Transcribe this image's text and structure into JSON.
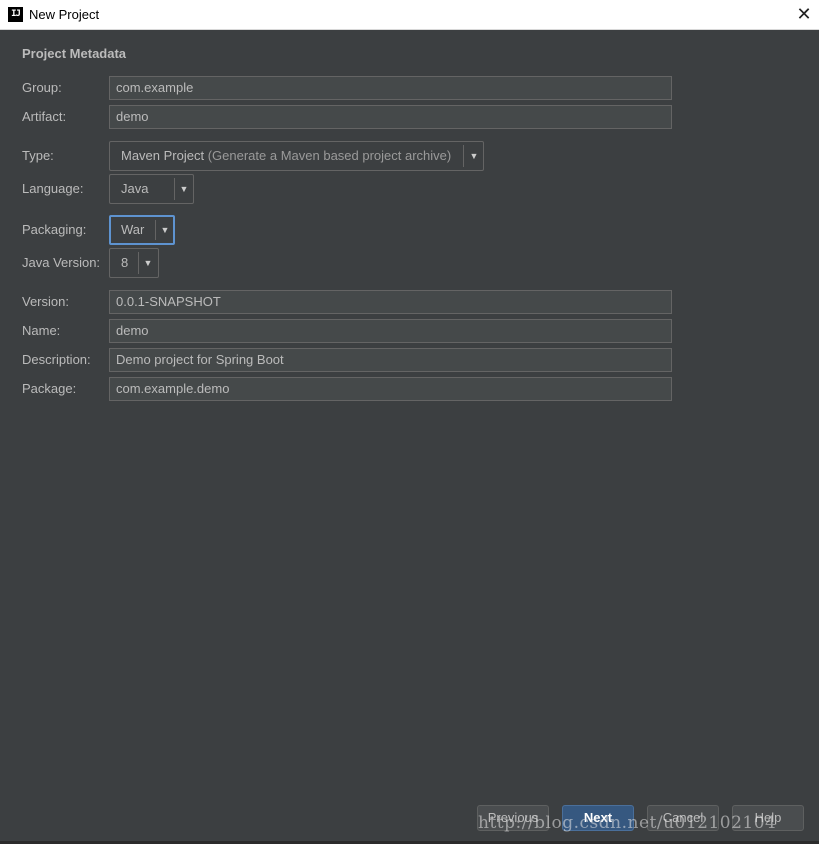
{
  "window": {
    "title": "New Project",
    "app_icon_text": "IJ"
  },
  "section": {
    "title": "Project Metadata"
  },
  "form": {
    "group": {
      "label": "Group:",
      "value": "com.example"
    },
    "artifact": {
      "label": "Artifact:",
      "value": "demo"
    },
    "type": {
      "label": "Type:",
      "value": "Maven Project",
      "description": "(Generate a Maven based project archive)"
    },
    "language": {
      "label": "Language:",
      "value": "Java"
    },
    "packaging": {
      "label": "Packaging:",
      "value": "War"
    },
    "java_version": {
      "label": "Java Version:",
      "value": "8"
    },
    "version": {
      "label": "Version:",
      "value": "0.0.1-SNAPSHOT"
    },
    "name": {
      "label": "Name:",
      "value": "demo"
    },
    "description": {
      "label": "Description:",
      "value": "Demo project for Spring Boot"
    },
    "package": {
      "label": "Package:",
      "value": "com.example.demo"
    }
  },
  "buttons": {
    "previous": "Previous",
    "next": "Next",
    "cancel": "Cancel",
    "help": "Help"
  },
  "icons": {
    "close": "close-icon",
    "dropdown": "chevron-down-icon",
    "app": "intellij-icon"
  },
  "watermark": "http://blog.csdn.net/u012102104",
  "colors": {
    "background": "#3c3f41",
    "field_background": "#45494a",
    "focus_border": "#5e93d0",
    "default_button": "#365880"
  }
}
